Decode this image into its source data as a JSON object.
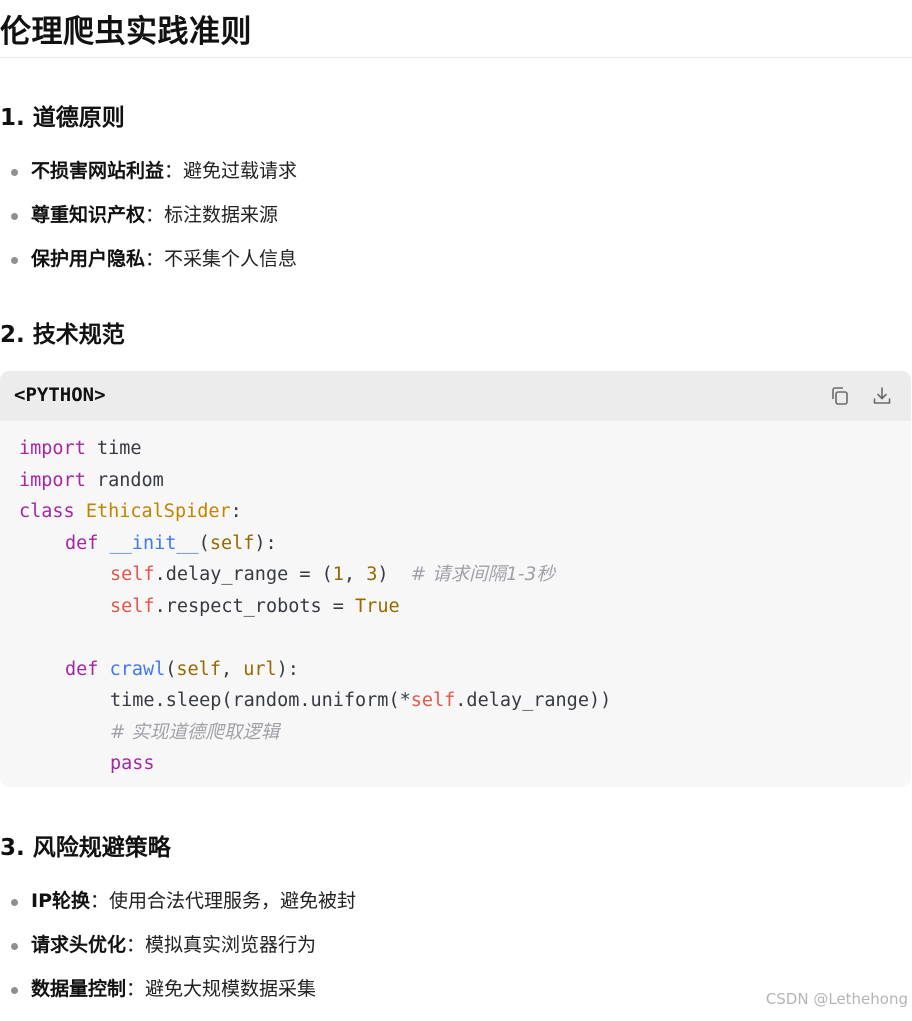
{
  "page": {
    "title": "伦理爬虫实践准则"
  },
  "sections": [
    {
      "heading": "1. 道德原则",
      "items": [
        {
          "term": "不损害网站利益",
          "desc": "：避免过载请求"
        },
        {
          "term": "尊重知识产权",
          "desc": "：标注数据来源"
        },
        {
          "term": "保护用户隐私",
          "desc": "：不采集个人信息"
        }
      ]
    },
    {
      "heading": "2. 技术规范"
    },
    {
      "heading": "3. 风险规避策略",
      "items": [
        {
          "term": "IP轮换",
          "desc": "：使用合法代理服务，避免被封"
        },
        {
          "term": "请求头优化",
          "desc": "：模拟真实浏览器行为"
        },
        {
          "term": "数据量控制",
          "desc": "：避免大规模数据采集"
        }
      ]
    }
  ],
  "code_block": {
    "language_label": "<PYTHON>",
    "copy_icon": "copy-icon",
    "download_icon": "download-icon",
    "tokens": {
      "import": "import",
      "time": "time",
      "random": "random",
      "class": "class",
      "class_name": "EthicalSpider",
      "colon": ":",
      "def": "def",
      "init": "__init__",
      "open_paren": "(",
      "close_paren_colon": "):",
      "self": "self",
      "delay_range_attr": ".delay_range = (",
      "one": "1",
      "comma_space": ", ",
      "three": "3",
      "close_paren": ")",
      "comment_interval": "# 请求间隔1-3秒",
      "respect_robots_attr": ".respect_robots = ",
      "true": "True",
      "crawl": "crawl",
      "url": "url",
      "sleep_call": "time.sleep(random.uniform(*",
      "delay_range_tail": ".delay_range))",
      "comment_logic": "# 实现道德爬取逻辑",
      "pass": "pass"
    }
  },
  "watermark": "CSDN @Lethehong",
  "colors": {
    "keyword": "#a626a4",
    "class_name": "#c18401",
    "function": "#4078f2",
    "self": "#e45649",
    "number": "#986801",
    "comment": "#a0a1a7",
    "code_background": "#f7f7f7",
    "code_header_background": "#ececec"
  }
}
